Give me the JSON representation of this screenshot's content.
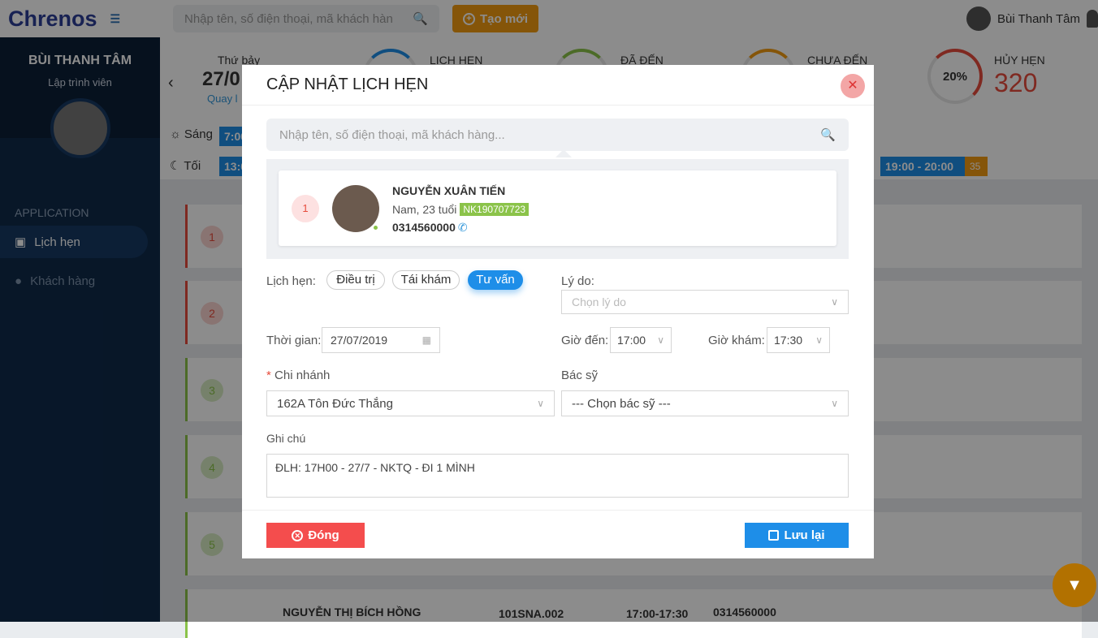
{
  "app": {
    "logo": "Chrenos",
    "search_placeholder": "Nhập tên, số điện thoại, mã khách hàn",
    "new_button": "Tạo mới",
    "user_name": "Bùi Thanh Tâm"
  },
  "sidebar": {
    "name": "BÙI THANH TÂM",
    "role": "Lập trình viên",
    "section": "APPLICATION",
    "items": [
      {
        "label": "Lịch hẹn"
      },
      {
        "label": "Khách hàng"
      }
    ]
  },
  "header": {
    "weekday": "Thứ bảy",
    "date": "27/0",
    "back_link": "Quay l",
    "stats": [
      {
        "label": "LỊCH HẸN"
      },
      {
        "label": "ĐÃ ĐẾN"
      },
      {
        "label": "CHƯA ĐẾN"
      },
      {
        "label": "HỦY HẸN",
        "percent": "20%",
        "value": "320"
      }
    ]
  },
  "shifts": {
    "morning": "Sáng",
    "evening": "Tối",
    "m_slot": "7:00",
    "e_slot": "13:0",
    "slot_right": "19:00 - 20:00",
    "slot_count": "35"
  },
  "rows": [
    "1",
    "2",
    "3",
    "4",
    "5"
  ],
  "bottom_row": {
    "name": "NGUYỄN THỊ BÍCH HỒNG",
    "room": "101SNA.002",
    "time": "17:00-17:30",
    "phone": "0314560000"
  },
  "modal": {
    "title": "CẬP NHẬT LỊCH HẸN",
    "search_placeholder": "Nhập tên, số điện thoại, mã khách hàng...",
    "customer": {
      "index": "1",
      "name": "NGUYỄN XUÂN TIẾN",
      "info": "Nam, 23 tuổi",
      "code": "NK190707723",
      "phone": "0314560000"
    },
    "type_label": "Lịch hẹn:",
    "types": [
      "Điều trị",
      "Tái khám",
      "Tư vấn"
    ],
    "reason_label": "Lý do:",
    "reason_placeholder": "Chọn lý do",
    "time_label": "Thời gian:",
    "date_value": "27/07/2019",
    "arrive_label": "Giờ đến:",
    "arrive_value": "17:00",
    "exam_label": "Giờ khám:",
    "exam_value": "17:30",
    "branch_label": "Chi nhánh",
    "branch_value": "162A Tôn Đức Thắng",
    "doctor_label": "Bác sỹ",
    "doctor_value": "--- Chọn bác sỹ ---",
    "note_label": "Ghi chú",
    "note_value": "ĐLH: 17H00 - 27/7 - NKTQ - ĐI 1 MÌNH",
    "close_button": "Đóng",
    "save_button": "Lưu lại"
  }
}
